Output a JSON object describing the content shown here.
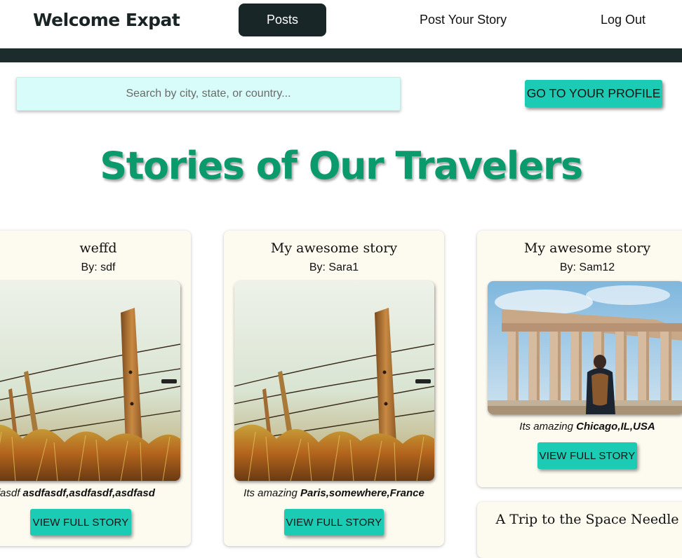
{
  "nav": {
    "brand": "Welcome Expat",
    "posts": "Posts",
    "post_story": "Post Your Story",
    "logout": "Log Out"
  },
  "search": {
    "placeholder": "Search by city, state, or country..."
  },
  "profile_button": "GO TO YOUR PROFILE",
  "page_title": "Stories of Our Travelers",
  "cards": [
    {
      "title": "weffd",
      "author": "By: sdf",
      "image": "fence-photo",
      "desc_prefix": "sdfasdf",
      "desc_location": "asdfasdf,asdfasdf,asdfasd",
      "button": "VIEW FULL STORY"
    },
    {
      "title": "My awesome story",
      "author": "By: Sara1",
      "image": "fence-photo",
      "desc_prefix": "Its amazing",
      "desc_location": "Paris,somewhere,France",
      "button": "VIEW FULL STORY"
    },
    {
      "title": "My awesome story",
      "author": "By: Sam12",
      "image": "parthenon-photo",
      "desc_prefix": "Its amazing",
      "desc_location": "Chicago,IL,USA",
      "button": "VIEW FULL STORY"
    },
    {
      "title": "A Trip to the Space Needle"
    }
  ],
  "colors": {
    "accent": "#1ccbb3",
    "nav_dark": "#182627",
    "title_green": "#0a9a6c",
    "search_bg": "#d8fcfa",
    "card_bg": "#fdfaf0"
  }
}
